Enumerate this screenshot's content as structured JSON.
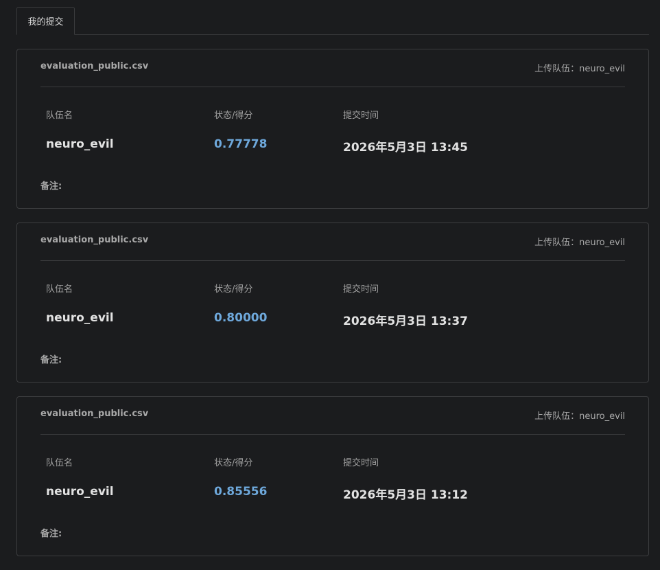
{
  "tabs": [
    {
      "label": "我的提交",
      "active": true
    }
  ],
  "columns": {
    "team": "队伍名",
    "status_score": "状态/得分",
    "submit_time": "提交时间"
  },
  "note_label": "备注:",
  "colors": {
    "background": "#1b1c1e",
    "border": "#3d3e40",
    "score": "#6ea8db"
  },
  "submissions": [
    {
      "file": "evaluation_public.csv",
      "uploader": "上传队伍：neuro_evil",
      "team": "neuro_evil",
      "score": "0.77778",
      "time": "2026年5月3日 13:45"
    },
    {
      "file": "evaluation_public.csv",
      "uploader": "上传队伍：neuro_evil",
      "team": "neuro_evil",
      "score": "0.80000",
      "time": "2026年5月3日 13:37"
    },
    {
      "file": "evaluation_public.csv",
      "uploader": "上传队伍：neuro_evil",
      "team": "neuro_evil",
      "score": "0.85556",
      "time": "2026年5月3日 13:12"
    }
  ]
}
